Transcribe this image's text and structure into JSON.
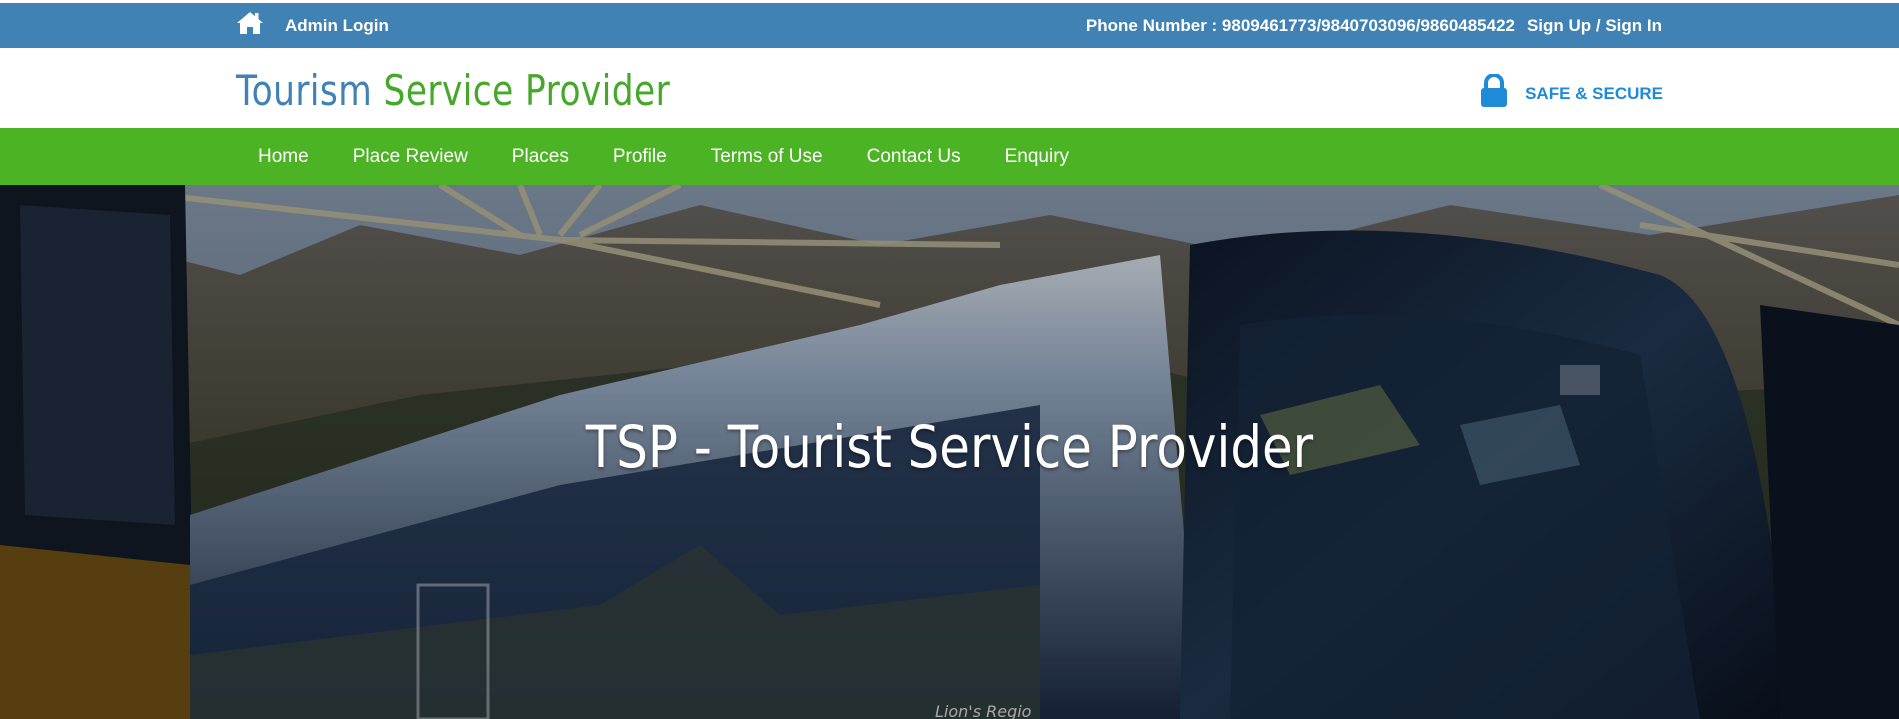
{
  "topbar": {
    "home_icon": "home-icon",
    "admin_login": "Admin Login",
    "phone": "Phone Number : 9809461773/9840703096/9860485422",
    "signin": "Sign Up / Sign In"
  },
  "header": {
    "brand_part1": "Tourism",
    "brand_part2": "Service Provider",
    "secure_icon": "lock-icon",
    "secure_label": "SAFE & SECURE"
  },
  "nav": {
    "items": [
      {
        "label": "Home"
      },
      {
        "label": "Place Review"
      },
      {
        "label": "Places"
      },
      {
        "label": "Profile"
      },
      {
        "label": "Terms of Use"
      },
      {
        "label": "Contact Us"
      },
      {
        "label": "Enquiry"
      }
    ]
  },
  "hero": {
    "title": "TSP - Tourist Service Provider",
    "bus_text": "Lion's Regio"
  },
  "colors": {
    "topbar": "#3f82b3",
    "brand_blue": "#3f82b3",
    "brand_green": "#45a82a",
    "nav": "#4cb424",
    "secure": "#1f8ad8"
  }
}
